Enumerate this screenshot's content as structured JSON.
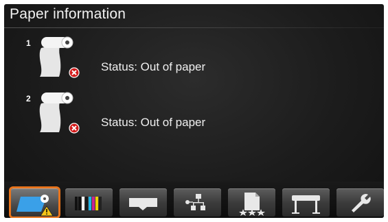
{
  "header": {
    "title": "Paper information"
  },
  "rolls": [
    {
      "number": "1",
      "status": "Status: Out of paper"
    },
    {
      "number": "2",
      "status": "Status: Out of paper"
    }
  ],
  "toolbar": {
    "buttons": [
      {
        "name": "paper-info-tab",
        "icon": "paper-roll-warning-icon",
        "selected": true
      },
      {
        "name": "ink-tab",
        "icon": "ink-cartridges-icon",
        "selected": false
      },
      {
        "name": "output-tab",
        "icon": "output-tray-icon",
        "selected": false
      },
      {
        "name": "network-tab",
        "icon": "network-icon",
        "selected": false
      },
      {
        "name": "jobs-tab",
        "icon": "job-queue-icon",
        "selected": false
      },
      {
        "name": "printer-tab",
        "icon": "printer-icon",
        "selected": false
      },
      {
        "name": "setup-tab",
        "icon": "wrench-icon",
        "selected": false
      }
    ]
  },
  "colors": {
    "selection": "#e8741c",
    "error": "#d21b1b",
    "warning": "#f5c518",
    "ink": [
      "#1a1a1a",
      "#1fb6e8",
      "#c8258f",
      "#f0d000"
    ]
  }
}
